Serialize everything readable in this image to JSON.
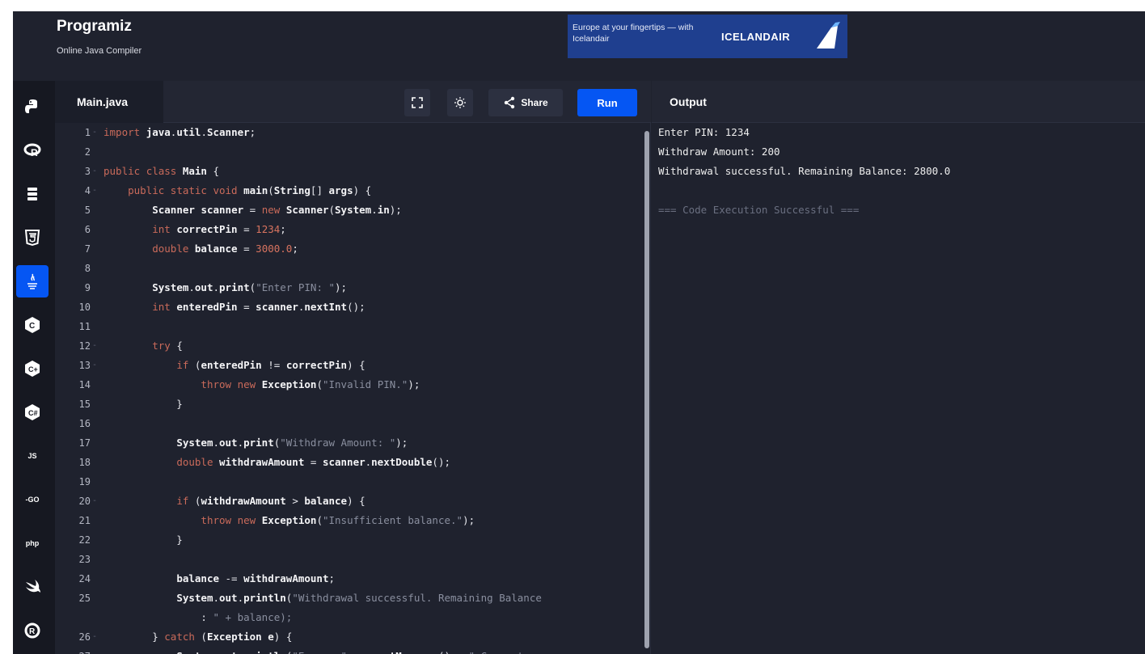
{
  "header": {
    "logo": "Programiz",
    "subtitle": "Online Java Compiler",
    "ad": {
      "text": "Europe at your fingertips — with Icelandair",
      "brand": "ICELANDAIR"
    }
  },
  "sidebar": {
    "items": [
      {
        "name": "python",
        "icon": "python-icon"
      },
      {
        "name": "r",
        "icon": "r-icon"
      },
      {
        "name": "sql",
        "icon": "database-icon"
      },
      {
        "name": "html",
        "icon": "html5-icon"
      },
      {
        "name": "java",
        "icon": "java-icon",
        "active": true
      },
      {
        "name": "c",
        "icon": "c-icon"
      },
      {
        "name": "cpp",
        "icon": "cpp-icon"
      },
      {
        "name": "csharp",
        "icon": "csharp-icon"
      },
      {
        "name": "javascript",
        "label": "JS"
      },
      {
        "name": "go",
        "label": "-GO"
      },
      {
        "name": "php",
        "label": "php"
      },
      {
        "name": "swift",
        "icon": "swift-icon"
      },
      {
        "name": "rust",
        "icon": "rust-icon"
      }
    ]
  },
  "editor": {
    "file_tab": "Main.java",
    "share_label": "Share",
    "run_label": "Run",
    "lines": [
      {
        "n": "1",
        "fold": true,
        "code": "import java.util.Scanner;"
      },
      {
        "n": "2",
        "fold": false,
        "code": ""
      },
      {
        "n": "3",
        "fold": true,
        "code": "public class Main {"
      },
      {
        "n": "4",
        "fold": true,
        "code": "    public static void main(String[] args) {"
      },
      {
        "n": "5",
        "fold": false,
        "code": "        Scanner scanner = new Scanner(System.in);"
      },
      {
        "n": "6",
        "fold": false,
        "code": "        int correctPin = 1234;"
      },
      {
        "n": "7",
        "fold": false,
        "code": "        double balance = 3000.0;"
      },
      {
        "n": "8",
        "fold": false,
        "code": ""
      },
      {
        "n": "9",
        "fold": false,
        "code": "        System.out.print(\"Enter PIN: \");"
      },
      {
        "n": "10",
        "fold": false,
        "code": "        int enteredPin = scanner.nextInt();"
      },
      {
        "n": "11",
        "fold": false,
        "code": ""
      },
      {
        "n": "12",
        "fold": true,
        "code": "        try {"
      },
      {
        "n": "13",
        "fold": true,
        "code": "            if (enteredPin != correctPin) {"
      },
      {
        "n": "14",
        "fold": false,
        "code": "                throw new Exception(\"Invalid PIN.\");"
      },
      {
        "n": "15",
        "fold": false,
        "code": "            }"
      },
      {
        "n": "16",
        "fold": false,
        "code": ""
      },
      {
        "n": "17",
        "fold": false,
        "code": "            System.out.print(\"Withdraw Amount: \");"
      },
      {
        "n": "18",
        "fold": false,
        "code": "            double withdrawAmount = scanner.nextDouble();"
      },
      {
        "n": "19",
        "fold": false,
        "code": ""
      },
      {
        "n": "20",
        "fold": true,
        "code": "            if (withdrawAmount > balance) {"
      },
      {
        "n": "21",
        "fold": false,
        "code": "                throw new Exception(\"Insufficient balance.\");"
      },
      {
        "n": "22",
        "fold": false,
        "code": "            }"
      },
      {
        "n": "23",
        "fold": false,
        "code": ""
      },
      {
        "n": "24",
        "fold": false,
        "code": "            balance -= withdrawAmount;"
      },
      {
        "n": "25",
        "fold": false,
        "code": "            System.out.println(\"Withdrawal successful. Remaining Balance"
      },
      {
        "n": "",
        "fold": false,
        "code": "                : \" + balance);"
      },
      {
        "n": "26",
        "fold": true,
        "code": "        } catch (Exception e) {"
      },
      {
        "n": "27",
        "fold": false,
        "code": "            System.out.println(\"Error: \" + e.getMessage() + \" Current"
      }
    ]
  },
  "output": {
    "title": "Output",
    "lines": [
      "Enter PIN: 1234",
      "Withdraw Amount: 200",
      "Withdrawal successful. Remaining Balance: 2800.0",
      "",
      "=== Code Execution Successful ==="
    ]
  },
  "colors": {
    "background": "#1f222e",
    "sidebar": "#161821",
    "accent": "#0556f3",
    "keyword": "#c96a5a",
    "string": "#8a8f9f"
  }
}
